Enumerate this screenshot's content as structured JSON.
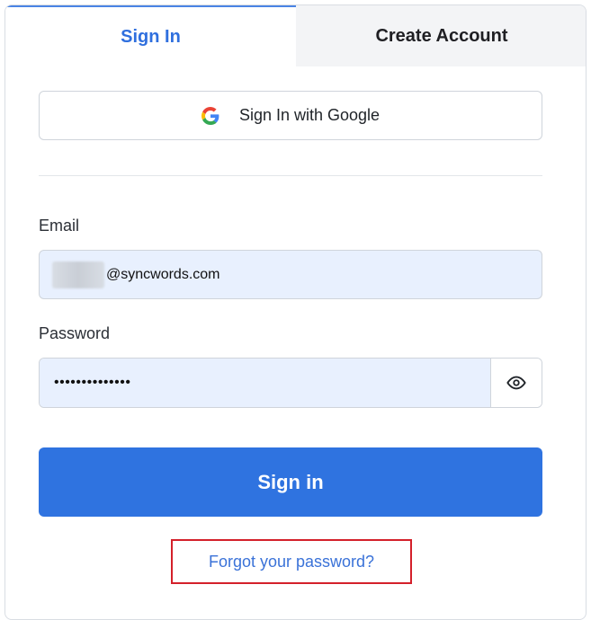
{
  "tabs": {
    "signin_label": "Sign In",
    "create_label": "Create Account"
  },
  "google": {
    "label": "Sign In with Google",
    "icon": "google-icon"
  },
  "form": {
    "email_label": "Email",
    "email_value_visible": "@syncwords.com",
    "password_label": "Password",
    "password_value": "••••••••••••••",
    "toggle_icon": "eye-icon"
  },
  "actions": {
    "signin_label": "Sign in",
    "forgot_label": "Forgot your password?"
  },
  "colors": {
    "accent": "#2f73e0",
    "active_tab": "#2f6fde",
    "autofill_bg": "#e8f0fe",
    "highlight_border": "#d4202a"
  }
}
